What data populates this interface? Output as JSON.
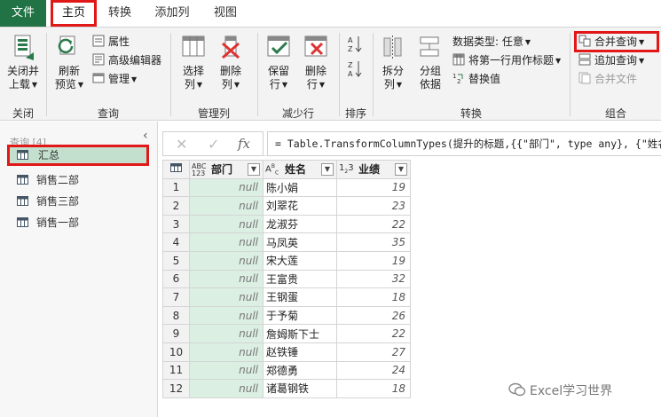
{
  "tabs": {
    "file": "文件",
    "home": "主页",
    "transform": "转换",
    "add_column": "添加列",
    "view": "视图"
  },
  "ribbon": {
    "close_group": {
      "btn_line1": "关闭并",
      "btn_line2": "上载",
      "label": "关闭"
    },
    "query_group": {
      "refresh_line1": "刷新",
      "refresh_line2": "预览",
      "properties": "属性",
      "advanced_editor": "高级编辑器",
      "manage": "管理",
      "label": "查询"
    },
    "manage_cols_group": {
      "choose_line1": "选择",
      "choose_line2": "列",
      "remove_line1": "删除",
      "remove_line2": "列",
      "label": "管理列"
    },
    "reduce_rows_group": {
      "keep_line1": "保留",
      "keep_line2": "行",
      "remove_line1": "删除",
      "remove_line2": "行",
      "label": "减少行"
    },
    "sort_group": {
      "label": "排序"
    },
    "transform_group": {
      "split_line1": "拆分",
      "split_line2": "列",
      "group_line1": "分组",
      "group_line2": "依据",
      "data_type": "数据类型: 任意",
      "first_row_header": "将第一行用作标题",
      "replace_values": "替换值",
      "label": "转换"
    },
    "combine_group": {
      "merge_queries": "合并查询",
      "append_queries": "追加查询",
      "combine_files": "合并文件",
      "label": "组合"
    }
  },
  "query_pane": {
    "header": "查询 [4]",
    "items": [
      "汇总",
      "销售二部",
      "销售三部",
      "销售一部"
    ]
  },
  "formula_bar": {
    "fx": "fx",
    "formula": "= Table.TransformColumnTypes(提升的标题,{{\"部门\", type any}, {\"姓名\","
  },
  "table": {
    "columns": [
      {
        "type": "ABC\n123",
        "name": "部门"
      },
      {
        "type": "AB C",
        "name": "姓名"
      },
      {
        "type": "1 2 3",
        "name": "业绩"
      }
    ],
    "rows": [
      {
        "n": "1",
        "dept": "null",
        "name": "陈小娟",
        "perf": "19"
      },
      {
        "n": "2",
        "dept": "null",
        "name": "刘翠花",
        "perf": "23"
      },
      {
        "n": "3",
        "dept": "null",
        "name": "龙淑芬",
        "perf": "22"
      },
      {
        "n": "4",
        "dept": "null",
        "name": "马凤英",
        "perf": "35"
      },
      {
        "n": "5",
        "dept": "null",
        "name": "宋大莲",
        "perf": "19"
      },
      {
        "n": "6",
        "dept": "null",
        "name": "王富贵",
        "perf": "32"
      },
      {
        "n": "7",
        "dept": "null",
        "name": "王钢蛋",
        "perf": "18"
      },
      {
        "n": "8",
        "dept": "null",
        "name": "于予菊",
        "perf": "26"
      },
      {
        "n": "9",
        "dept": "null",
        "name": "詹姆斯下士",
        "perf": "22"
      },
      {
        "n": "10",
        "dept": "null",
        "name": "赵铁锤",
        "perf": "27"
      },
      {
        "n": "11",
        "dept": "null",
        "name": "郑德勇",
        "perf": "24"
      },
      {
        "n": "12",
        "dept": "null",
        "name": "诸葛钢铁",
        "perf": "18"
      }
    ]
  },
  "watermark": "Excel学习世界",
  "colors": {
    "accent_green": "#217346",
    "highlight_red": "#e01818",
    "selected_query": "#c2e0cd",
    "column_tint": "#dcefe3"
  }
}
